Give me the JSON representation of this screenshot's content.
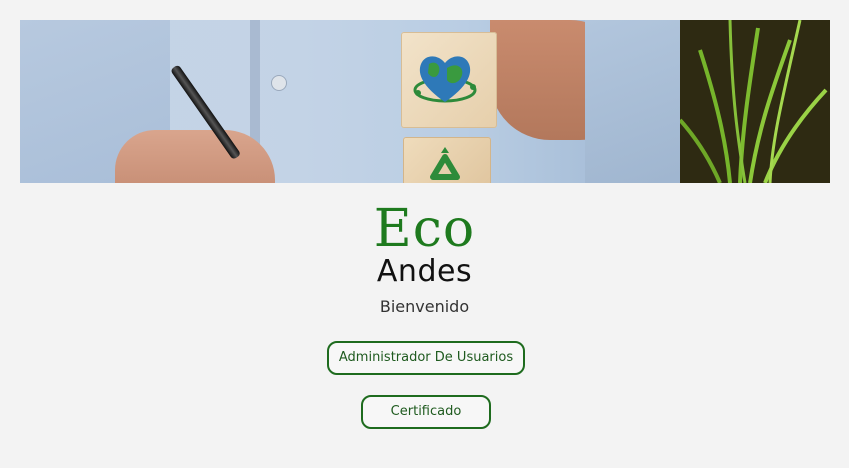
{
  "hero": {
    "icon_top": "earth-heart-icon",
    "icon_bottom": "recycle-icon"
  },
  "brand": {
    "line1": "Eco",
    "line2": "Andes",
    "colors": {
      "line1": "#1e7a1e",
      "line2": "#111111"
    }
  },
  "welcome": {
    "text": "Bienvenido"
  },
  "actions": {
    "admin_label": "Administrador De Usuarios",
    "certificate_label": "Certificado",
    "accent": "#1e6b1e"
  }
}
